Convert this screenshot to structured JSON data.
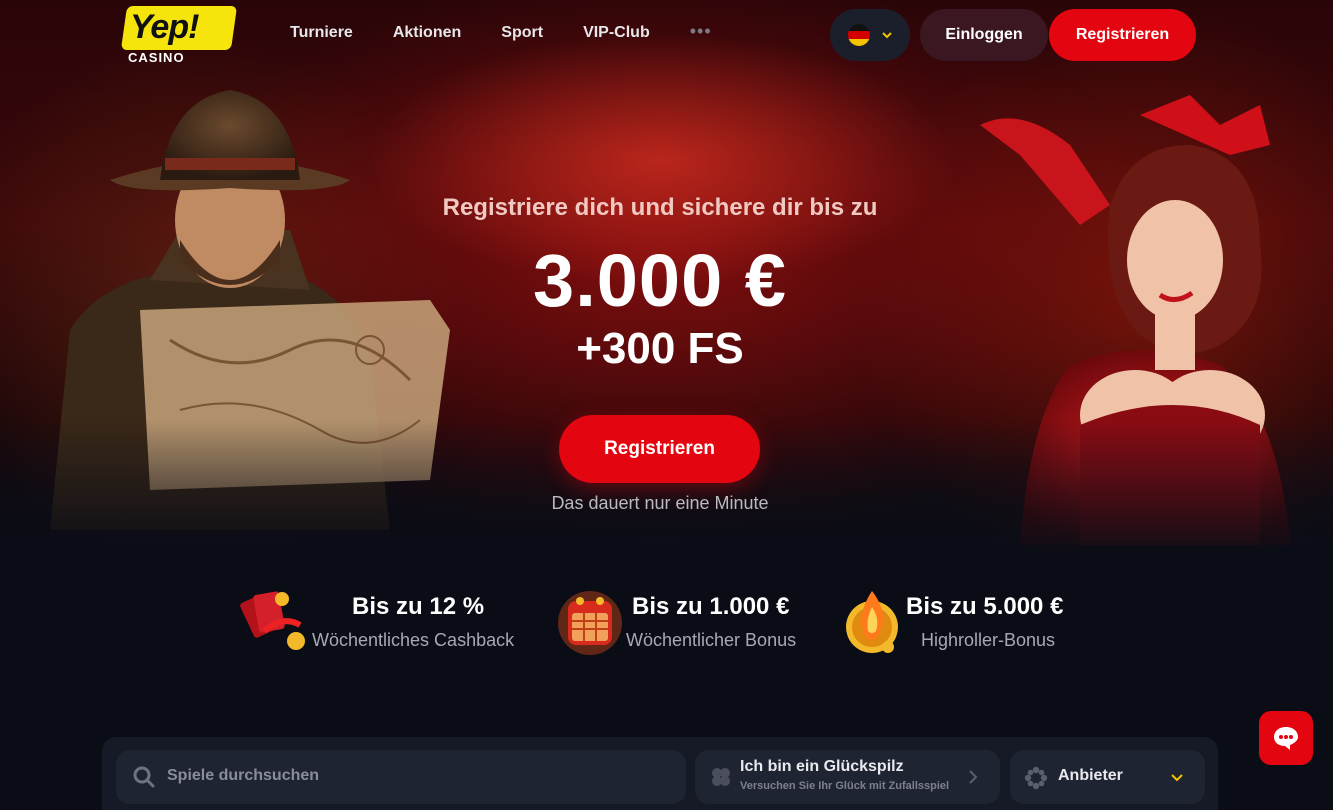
{
  "header": {
    "logo_text": "Yep!",
    "logo_sub": "CASINO",
    "nav": [
      {
        "label": "Turniere"
      },
      {
        "label": "Aktionen"
      },
      {
        "label": "Sport"
      },
      {
        "label": "VIP-Club"
      }
    ],
    "more_label": "•••",
    "language_icon": "flag-de-icon",
    "login_label": "Einloggen",
    "register_label": "Registrieren"
  },
  "hero": {
    "subtitle": "Registriere dich und sichere dir bis zu",
    "amount": "3.000 €",
    "free_spins": "+300 FS",
    "cta_label": "Registrieren",
    "note": "Das dauert nur eine Minute"
  },
  "perks": [
    {
      "icon": "cashback-cards-icon",
      "title": "Bis zu 12 %",
      "desc": "Wöchentliches Cashback"
    },
    {
      "icon": "calendar-bonus-icon",
      "title": "Bis zu 1.000 €",
      "desc": "Wöchentlicher Bonus"
    },
    {
      "icon": "flame-gem-icon",
      "title": "Bis zu 5.000 €",
      "desc": "Highroller-Bonus"
    }
  ],
  "search": {
    "placeholder": "Spiele durchsuchen",
    "lucky_title": "Ich bin ein Glückspilz",
    "lucky_sub": "Versuchen Sie Ihr Glück mit Zufallsspiel",
    "provider_label": "Anbieter"
  },
  "colors": {
    "accent": "#e3050f",
    "login_bg": "#3a1721",
    "logo_yellow": "#f5e50c",
    "page_bg": "#0b0d16"
  }
}
